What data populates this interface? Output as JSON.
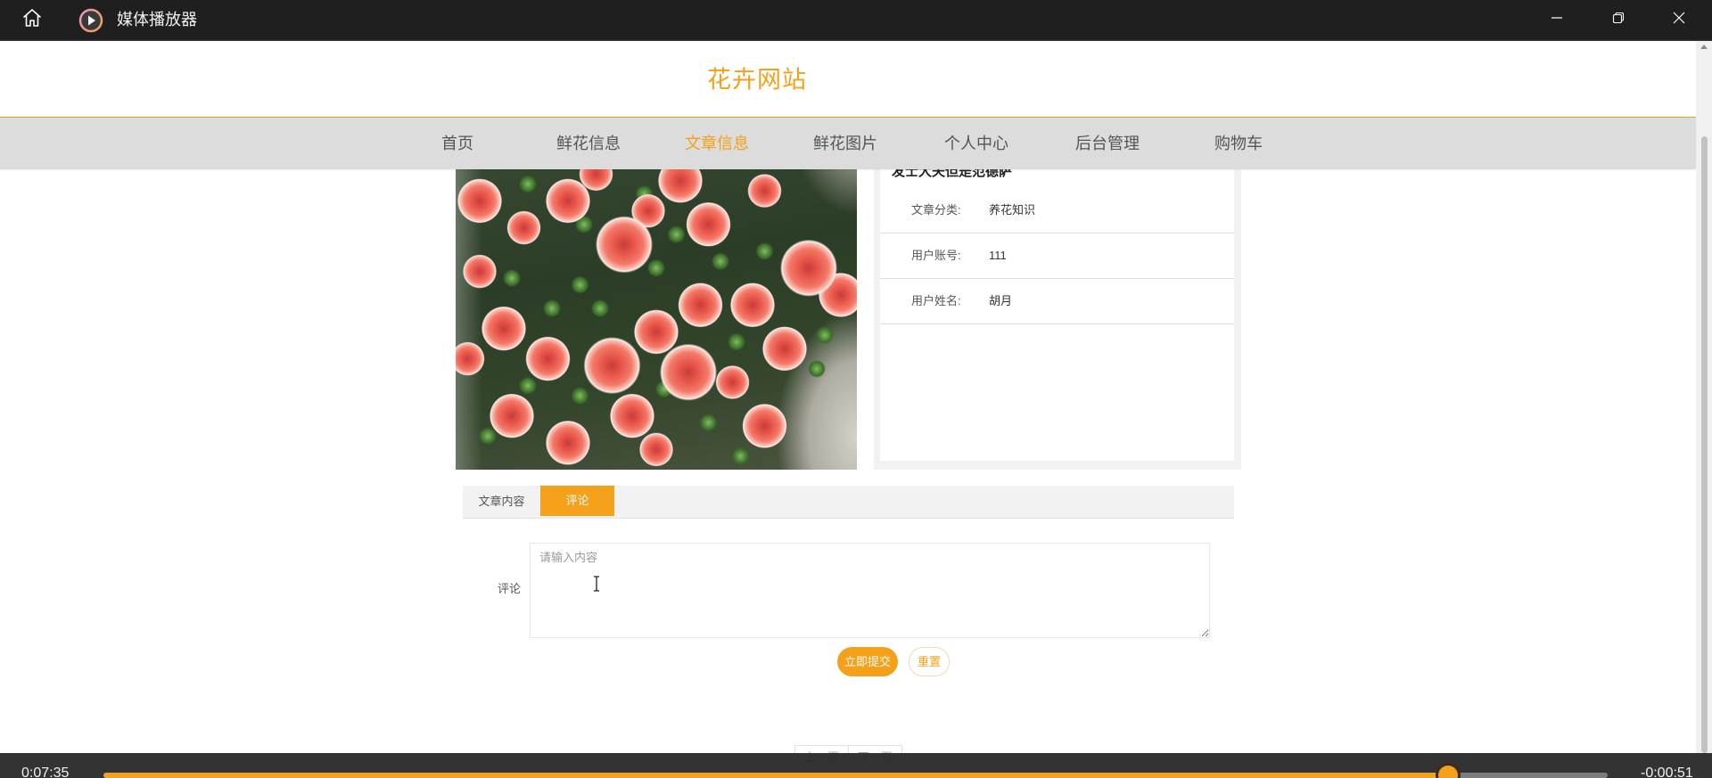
{
  "window": {
    "title": "媒体播放器",
    "icons": {
      "home": "home-icon",
      "app": "media-player-icon",
      "minimize": "minimize-icon",
      "restore": "restore-icon",
      "close": "close-icon"
    }
  },
  "theme": {
    "accent": "#f5a01a",
    "nav_background": "#dcdcdc"
  },
  "site": {
    "title": "花卉网站"
  },
  "nav": {
    "items": [
      {
        "label": "首页",
        "active": false
      },
      {
        "label": "鲜花信息",
        "active": false
      },
      {
        "label": "文章信息",
        "active": true
      },
      {
        "label": "鲜花图片",
        "active": false
      },
      {
        "label": "个人中心",
        "active": false
      },
      {
        "label": "后台管理",
        "active": false
      },
      {
        "label": "购物车",
        "active": false
      }
    ]
  },
  "article": {
    "image_icon": "flower-photo-icon",
    "title": "发士大夫但是范德萨",
    "fields": [
      {
        "label": "文章分类:",
        "value": "养花知识"
      },
      {
        "label": "用户账号:",
        "value": "111"
      },
      {
        "label": "用户姓名:",
        "value": "胡月"
      }
    ]
  },
  "tabs": [
    {
      "label": "文章内容",
      "active": false
    },
    {
      "label": "评论",
      "active": true
    }
  ],
  "comment_form": {
    "label": "评论",
    "placeholder": "请输入内容",
    "value": "",
    "submit_label": "立即提交",
    "reset_label": "重置"
  },
  "pagination": {
    "prev_label": "上一页",
    "next_label": "下一页"
  },
  "player": {
    "elapsed": "0:07:35",
    "remaining": "-0:00:51",
    "progress": 0.894
  }
}
